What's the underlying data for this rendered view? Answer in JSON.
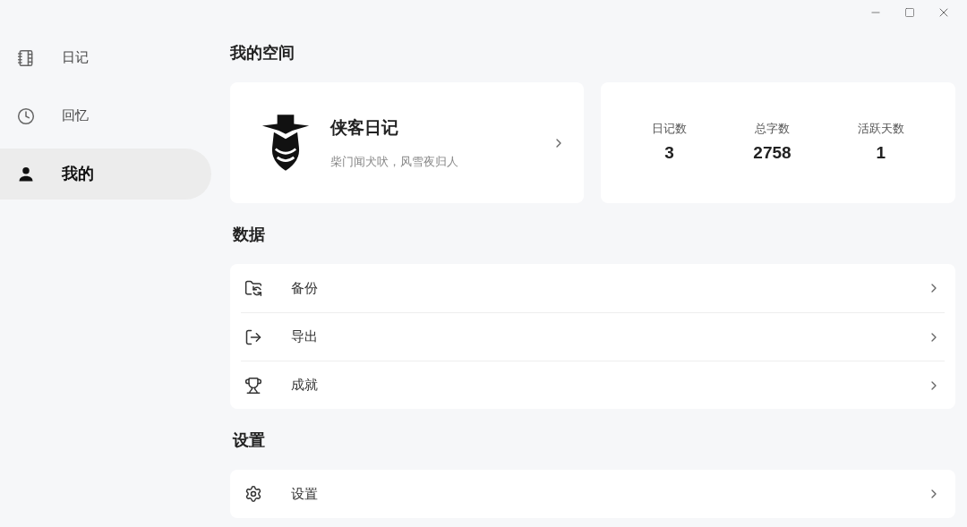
{
  "sidebar": {
    "items": [
      {
        "label": "日记",
        "selected": false
      },
      {
        "label": "回忆",
        "selected": false
      },
      {
        "label": "我的",
        "selected": true
      }
    ]
  },
  "page_title": "我的空间",
  "profile": {
    "name": "侠客日记",
    "motto": "柴门闻犬吠，风雪夜归人"
  },
  "stats": [
    {
      "label": "日记数",
      "value": "3"
    },
    {
      "label": "总字数",
      "value": "2758"
    },
    {
      "label": "活跃天数",
      "value": "1"
    }
  ],
  "sections": [
    {
      "title": "数据",
      "items": [
        {
          "label": "备份"
        },
        {
          "label": "导出"
        },
        {
          "label": "成就"
        }
      ]
    },
    {
      "title": "设置",
      "items": [
        {
          "label": "设置"
        }
      ]
    }
  ]
}
